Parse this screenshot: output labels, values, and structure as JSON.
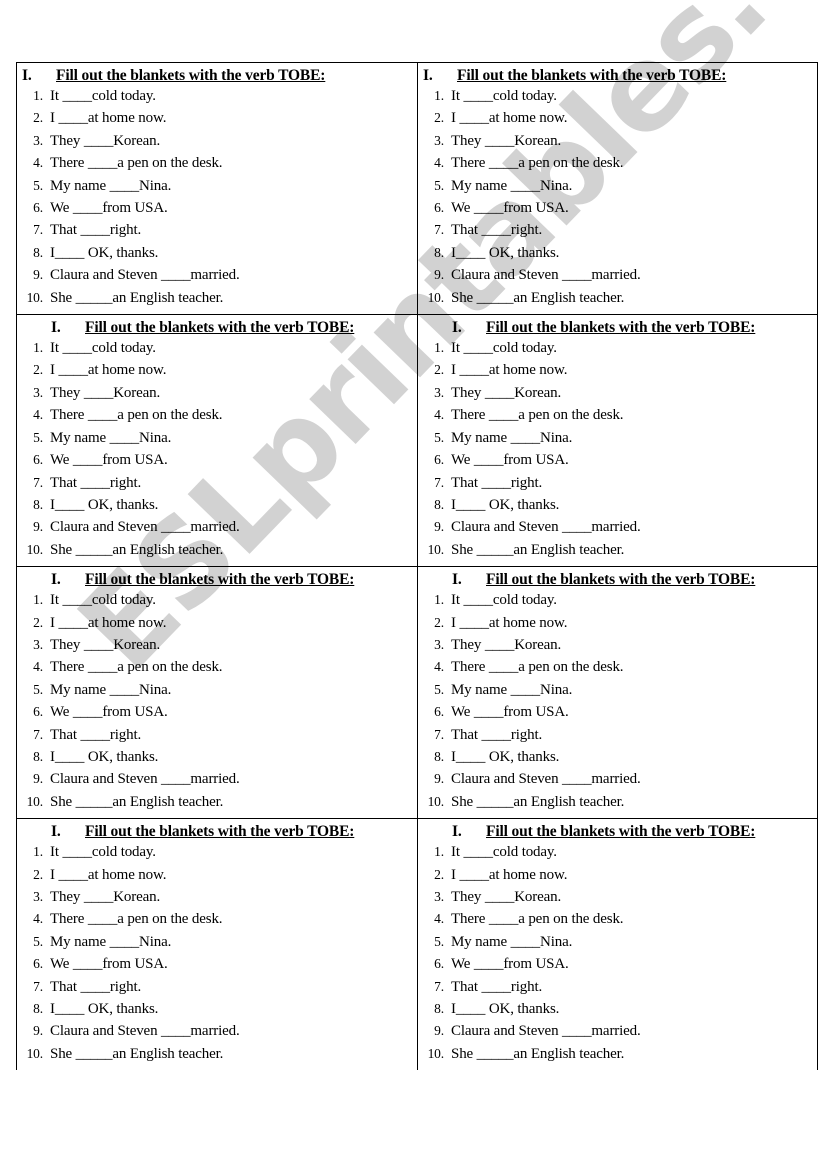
{
  "document": {
    "type": "esl-worksheet",
    "watermark": "ESLprintables.com",
    "watermark_color": "#d2d2d2",
    "text_color": "#000000",
    "border_color": "#000000",
    "page_background": "#ffffff"
  },
  "worksheet": {
    "heading": {
      "numeral": "I.",
      "text": "Fill out the blankets with the verb TOBE:"
    },
    "questions": [
      {
        "number": "1.",
        "text": "It ____cold today."
      },
      {
        "number": "2.",
        "text": "I ____at home now."
      },
      {
        "number": "3.",
        "text": "They ____Korean."
      },
      {
        "number": "4.",
        "text": "There ____a pen on the desk."
      },
      {
        "number": "5.",
        "text": "My name ____Nina."
      },
      {
        "number": "6.",
        "text": "We ____from USA."
      },
      {
        "number": "7.",
        "text": "That ____right."
      },
      {
        "number": "8.",
        "text": "I____ OK, thanks."
      },
      {
        "number": "9.",
        "text": "Claura and Steven ____married."
      },
      {
        "number": "10.",
        "text": "She _____an English teacher."
      }
    ]
  },
  "blocks": [
    {
      "id": "block-1-left",
      "row": 1,
      "column": "left",
      "indent": 0
    },
    {
      "id": "block-1-right",
      "row": 1,
      "column": "right",
      "indent": 0
    },
    {
      "id": "block-2-left",
      "row": 2,
      "column": "left",
      "indent": 1
    },
    {
      "id": "block-2-right",
      "row": 2,
      "column": "right",
      "indent": 1
    },
    {
      "id": "block-3-left",
      "row": 3,
      "column": "left",
      "indent": 1
    },
    {
      "id": "block-3-right",
      "row": 3,
      "column": "right",
      "indent": 1
    },
    {
      "id": "block-4-left",
      "row": 4,
      "column": "left",
      "indent": 1
    },
    {
      "id": "block-4-right",
      "row": 4,
      "column": "right",
      "indent": 1
    }
  ]
}
